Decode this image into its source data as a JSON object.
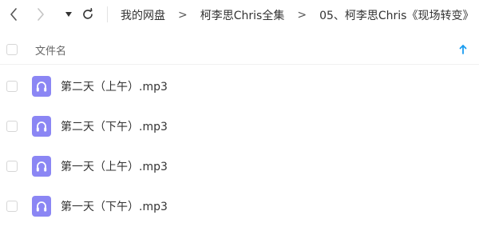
{
  "nav": {
    "back_icon": "chevron-left-icon",
    "forward_icon": "chevron-right-icon",
    "dropdown_icon": "caret-down-icon",
    "refresh_icon": "refresh-icon"
  },
  "breadcrumb": {
    "items": [
      "我的网盘",
      "柯李思Chris全集",
      "05、柯李思Chris《现场转变》"
    ],
    "separator": ">"
  },
  "list_header": {
    "name_label": "文件名",
    "sort_icon": "arrow-up-icon"
  },
  "files": [
    {
      "name": "第二天（上午）.mp3",
      "icon": "audio-file-icon"
    },
    {
      "name": "第二天（下午）.mp3",
      "icon": "audio-file-icon"
    },
    {
      "name": "第一天（上午）.mp3",
      "icon": "audio-file-icon"
    },
    {
      "name": "第一天（下午）.mp3",
      "icon": "audio-file-icon"
    }
  ],
  "colors": {
    "accent": "#1a9cf0",
    "audio_icon": "#8b86f4",
    "text": "#333333",
    "muted": "#666666"
  }
}
